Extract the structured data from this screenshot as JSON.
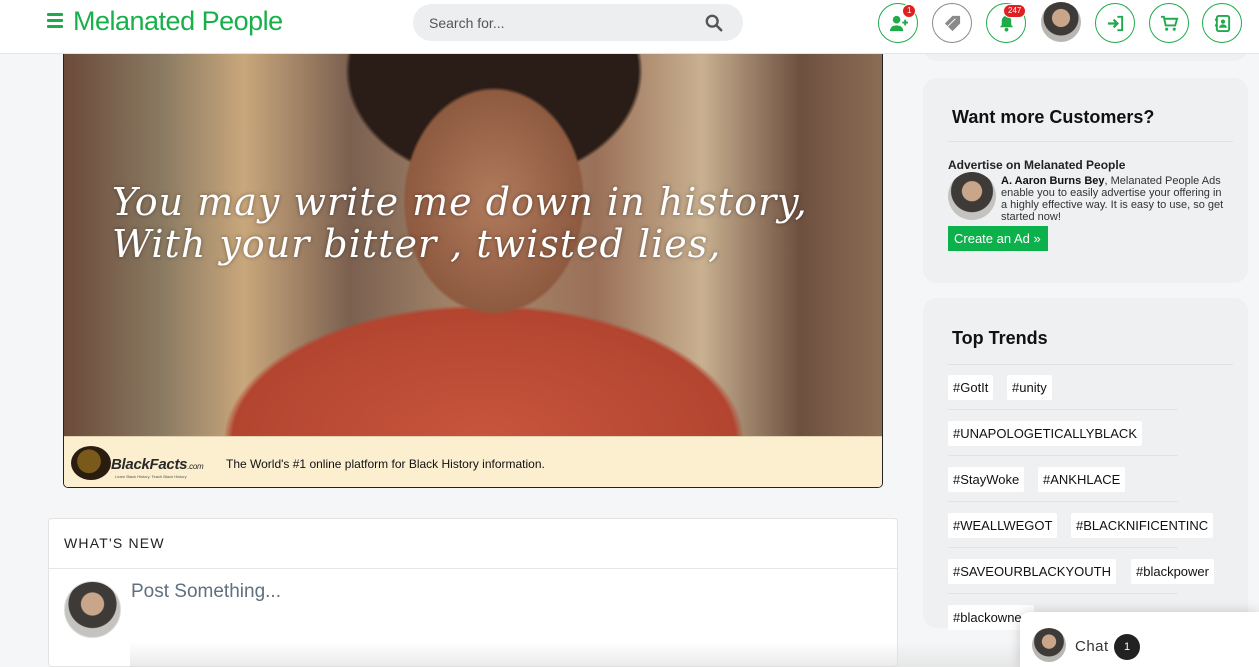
{
  "header": {
    "logo": "Melanated People",
    "search_placeholder": "Search for...",
    "friend_requests_badge": "1",
    "notifications_badge": "247"
  },
  "video": {
    "quote_line1": "You may write me down in history,",
    "quote_line2": "With your bitter , twisted lies,",
    "brand_name": "BlackFacts",
    "brand_suffix": ".com",
    "brand_tagline": "Learn Black History. Teach Black History",
    "bar_text": "The World's #1 online platform for Black History information."
  },
  "whats_new": {
    "title": "WHAT'S NEW",
    "post_placeholder": "Post Something..."
  },
  "ads": {
    "heading": "Want more Customers?",
    "subtitle": "Advertise on Melanated People",
    "author": "A. Aaron Burns Bey",
    "body": ", Melanated People Ads enable you to easily advertise your offering in a highly effective way. It is easy to use, so get started now!",
    "button": "Create an Ad »"
  },
  "trends": {
    "heading": "Top Trends",
    "items": [
      "#GotIt",
      "#unity",
      "#UNAPOLOGETICALLYBLACK",
      "#StayWoke",
      "#ANKHLACE",
      "#WEALLWEGOT",
      "#BLACKNIFICENTINC",
      "#SAVEOURBLACKYOUTH",
      "#blackpower",
      "#blackowned"
    ]
  },
  "chat": {
    "label": "Chat",
    "count": "1"
  },
  "colors": {
    "brand_green": "#17b04b",
    "button_green": "#0db14b",
    "badge_red": "#e02020"
  },
  "icons": [
    "menu-icon",
    "search-icon",
    "add-friend-icon",
    "tag-icon",
    "bell-icon",
    "sign-in-icon",
    "cart-icon",
    "contact-icon"
  ]
}
